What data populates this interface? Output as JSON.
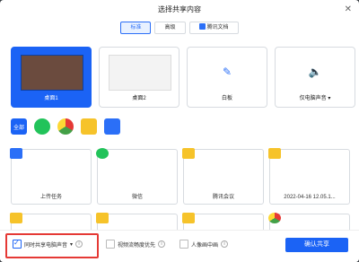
{
  "dialog": {
    "title": "选择共享内容",
    "close_icon": "close-icon"
  },
  "tabs": [
    {
      "label": "标准",
      "active": true
    },
    {
      "label": "高级",
      "active": false
    },
    {
      "label": "腾讯文档",
      "active": false,
      "icon": "tencent-docs-icon"
    }
  ],
  "share_targets": [
    {
      "label": "桌面1",
      "selected": true
    },
    {
      "label": "桌面2",
      "selected": false
    },
    {
      "label": "白板",
      "selected": false,
      "icon": "pen-icon"
    },
    {
      "label": "仅电脑声音",
      "selected": false,
      "icon": "speaker-icon"
    }
  ],
  "app_filters": [
    {
      "label": "全部",
      "icon": "all-icon"
    },
    {
      "label": "",
      "icon": "wechat-icon"
    },
    {
      "label": "",
      "icon": "chrome-icon"
    },
    {
      "label": "",
      "icon": "folder-icon"
    },
    {
      "label": "",
      "icon": "notes-icon"
    }
  ],
  "windows": [
    {
      "label": "上传任务",
      "icon": "note"
    },
    {
      "label": "微信",
      "icon": "wechat"
    },
    {
      "label": "腾讯会议",
      "icon": "folder"
    },
    {
      "label": "2022-04-16 12.05.1...",
      "icon": "folder"
    },
    {
      "label": "",
      "icon": "folder"
    },
    {
      "label": "",
      "icon": "folder"
    },
    {
      "label": "",
      "icon": "folder"
    },
    {
      "label": "",
      "icon": "chrome"
    }
  ],
  "options": {
    "share_sound": {
      "label": "同时共享电脑声音",
      "checked": true
    },
    "video_smooth": {
      "label": "视频流畅度优先",
      "checked": false
    },
    "portrait": {
      "label": "人像画中画",
      "checked": false
    }
  },
  "share_button": {
    "label": "确认共享"
  }
}
